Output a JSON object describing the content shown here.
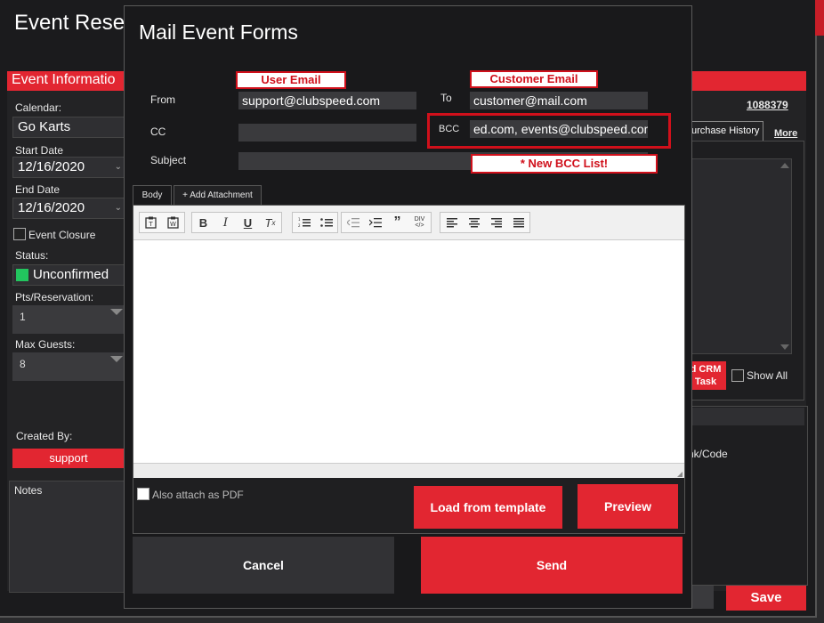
{
  "background": {
    "title": "Event Reser",
    "section_header": "Event Informatio",
    "calendar_label": "Calendar:",
    "calendar_value": "Go Karts",
    "start_date_label": "Start Date",
    "start_date_value": "12/16/2020",
    "end_date_label": "End Date",
    "end_date_value": "12/16/2020",
    "event_closure_label": "Event Closure",
    "status_label": "Status:",
    "status_value": "Unconfirmed",
    "pts_label": "Pts/Reservation:",
    "pts_value": "1",
    "max_guests_label": "Max Guests:",
    "max_guests_value": "8",
    "created_by_label": "Created By:",
    "created_by_value": "support",
    "notes_label": "Notes",
    "reservation_number": "1088379",
    "purchase_history_tab": "urchase History",
    "more_link": "More",
    "crm_button": "d CRM\nTask",
    "show_all_label": "Show All",
    "nk_code_label": "nk/Code",
    "save_button": "Save"
  },
  "modal": {
    "title": "Mail Event Forms",
    "from_label": "From",
    "from_value": "support@clubspeed.com",
    "to_label": "To",
    "to_value": "customer@mail.com",
    "cc_label": "CC",
    "cc_value": "",
    "bcc_label": "BCC",
    "bcc_value": "ed.com, events@clubspeed.com",
    "subject_label": "Subject",
    "subject_value": "",
    "tab_body": "Body",
    "tab_attachment": "+ Add Attachment",
    "attach_pdf_label": "Also attach as PDF",
    "load_template_button": "Load from template",
    "preview_button": "Preview",
    "cancel_button": "Cancel",
    "send_button": "Send"
  },
  "callouts": {
    "user_email": "User Email",
    "customer_email": "Customer Email",
    "new_bcc": "* New BCC List!"
  },
  "colors": {
    "accent": "#e22631",
    "status_green": "#22c55e",
    "callout_border": "#d0101b"
  }
}
